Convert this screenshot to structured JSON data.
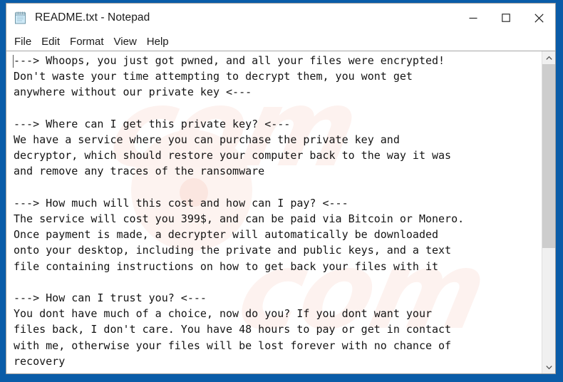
{
  "window": {
    "title": "README.txt - Notepad",
    "app_icon": "notepad-icon",
    "controls": {
      "minimize": "Minimize",
      "maximize": "Maximize",
      "close": "Close"
    }
  },
  "menubar": {
    "items": [
      {
        "label": "File"
      },
      {
        "label": "Edit"
      },
      {
        "label": "Format"
      },
      {
        "label": "View"
      },
      {
        "label": "Help"
      }
    ]
  },
  "editor": {
    "content": "---> Whoops, you just got pwned, and all your files were encrypted!\nDon't waste your time attempting to decrypt them, you wont get\nanywhere without our private key <---\n\n---> Where can I get this private key? <---\nWe have a service where you can purchase the private key and\ndecryptor, which should restore your computer back to the way it was\nand remove any traces of the ransomware\n\n---> How much will this cost and how can I pay? <---\nThe service will cost you 399$, and can be paid via Bitcoin or Monero.\nOnce payment is made, a decrypter will automatically be downloaded\nonto your desktop, including the private and public keys, and a text\nfile containing instructions on how to get back your files with it\n\n---> How can I trust you? <---\nYou dont have much of a choice, now do you? If you dont want your\nfiles back, I don't care. You have 48 hours to pay or get in contact\nwith me, otherwise your files will be lost forever with no chance of\nrecovery",
    "caret_visible": true,
    "watermark_text": "com"
  },
  "scrollbar": {
    "up_arrow": "scroll-up",
    "down_arrow": "scroll-down",
    "thumb_position_percent": 0,
    "thumb_size_percent": 62
  },
  "colors": {
    "desktop": "#0a5ca8",
    "window_bg": "#ffffff",
    "text": "#141414",
    "scrollbar_track": "#f0f0f0",
    "scrollbar_thumb": "#cdcdcd",
    "watermark": "#fdf2ef"
  }
}
